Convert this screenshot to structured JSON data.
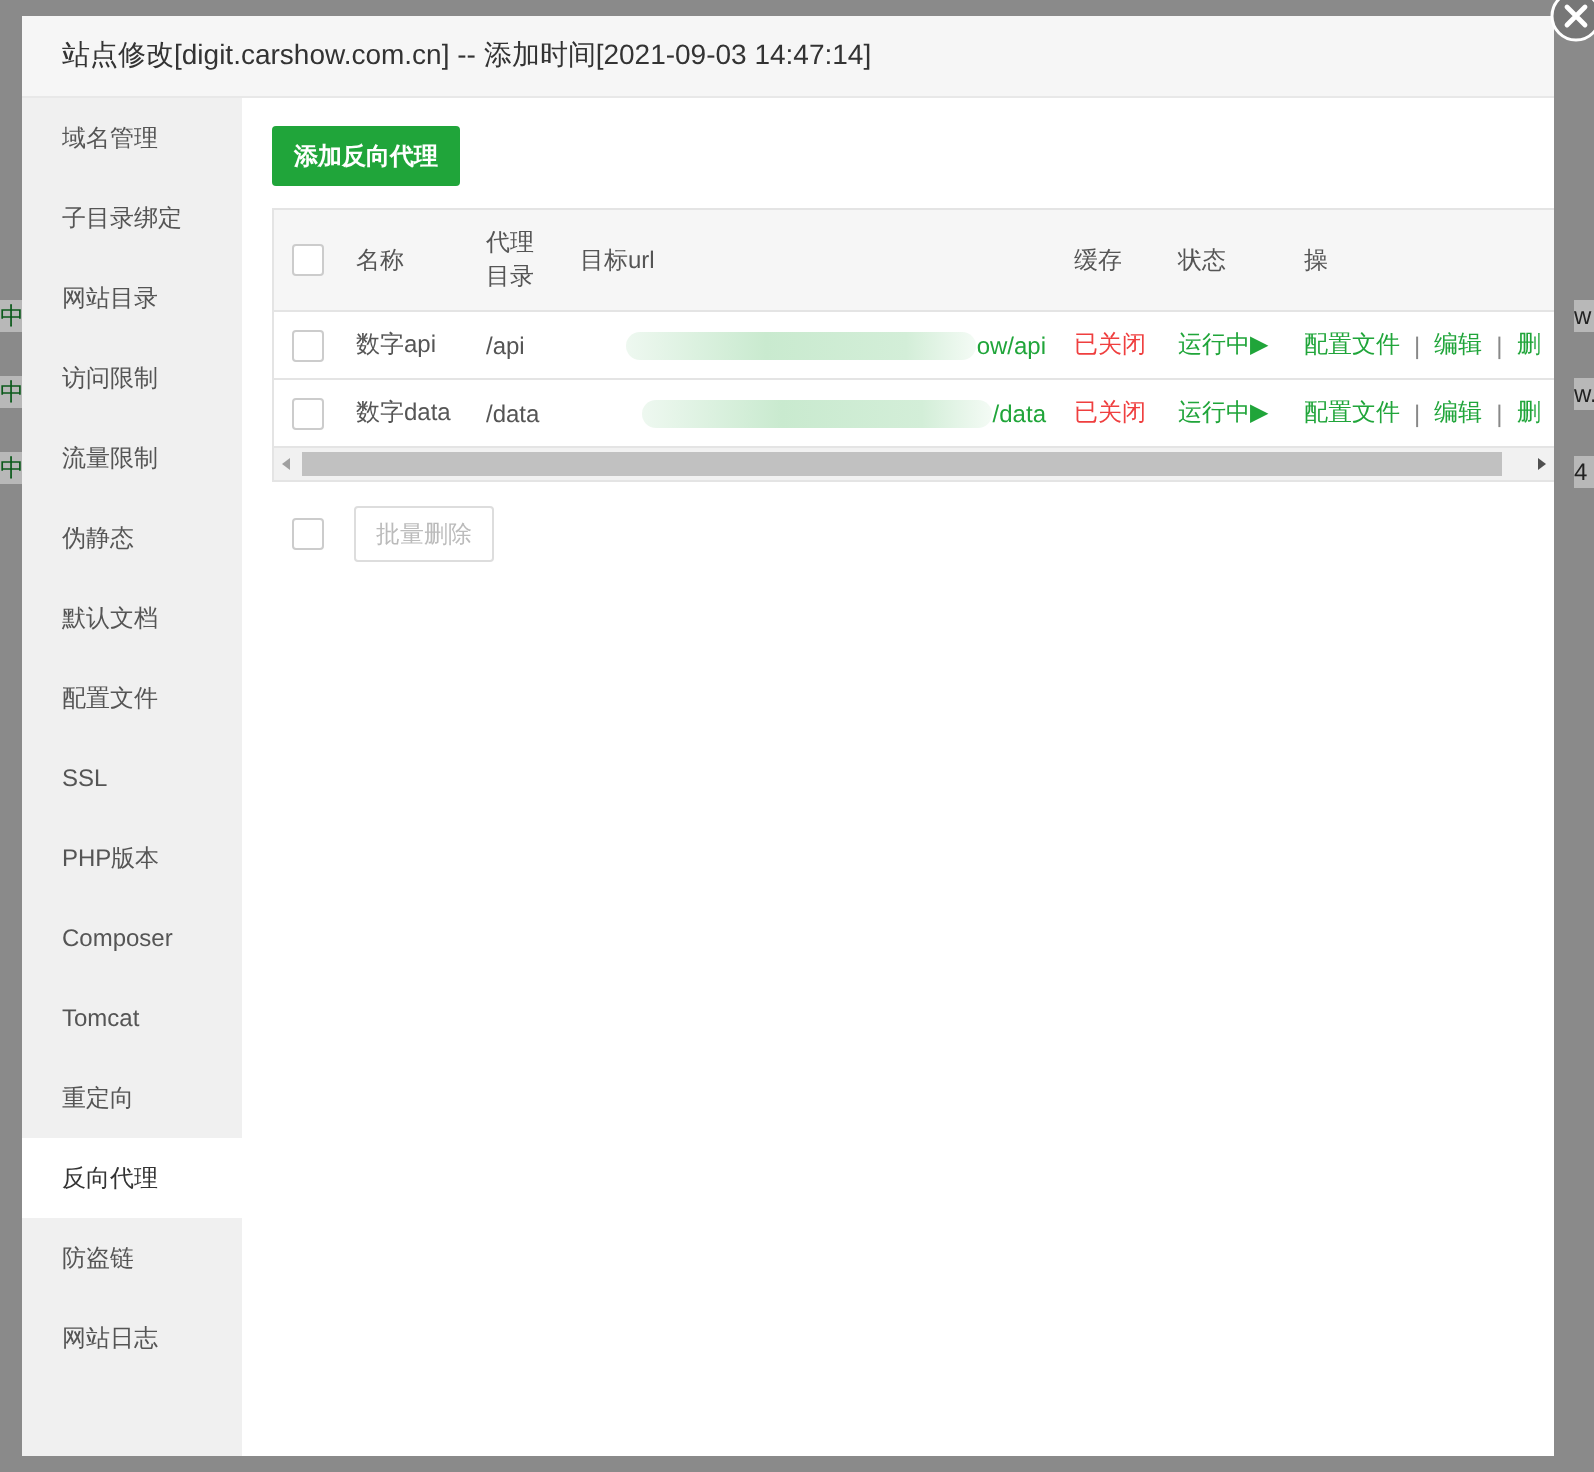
{
  "background": {
    "left_fragments": [
      "中",
      "中",
      "中"
    ],
    "right_fragments": [
      "w",
      "w.",
      "4"
    ]
  },
  "dialog": {
    "title": "站点修改[digit.carshow.com.cn] -- 添加时间[2021-09-03 14:47:14]"
  },
  "sidebar": {
    "items": [
      {
        "label": "域名管理",
        "selected": false
      },
      {
        "label": "子目录绑定",
        "selected": false
      },
      {
        "label": "网站目录",
        "selected": false
      },
      {
        "label": "访问限制",
        "selected": false
      },
      {
        "label": "流量限制",
        "selected": false
      },
      {
        "label": "伪静态",
        "selected": false
      },
      {
        "label": "默认文档",
        "selected": false
      },
      {
        "label": "配置文件",
        "selected": false
      },
      {
        "label": "SSL",
        "selected": false
      },
      {
        "label": "PHP版本",
        "selected": false
      },
      {
        "label": "Composer",
        "selected": false
      },
      {
        "label": "Tomcat",
        "selected": false
      },
      {
        "label": "重定向",
        "selected": false
      },
      {
        "label": "反向代理",
        "selected": true
      },
      {
        "label": "防盗链",
        "selected": false
      },
      {
        "label": "网站日志",
        "selected": false
      }
    ]
  },
  "add_button": "添加反向代理",
  "table": {
    "header_checked": false,
    "columns": [
      "名称",
      "代理目录",
      "目标url",
      "缓存",
      "状态",
      "操"
    ],
    "rows": [
      {
        "checked": false,
        "name": "数字api",
        "directory": "/api",
        "target_url": "ow/api",
        "url_redacted": true,
        "cache": "已关闭",
        "cache_on": false,
        "status": "运行中▶",
        "running": true,
        "actions": [
          "配置文件",
          "|",
          "编辑",
          "|",
          "删"
        ]
      },
      {
        "checked": false,
        "name": "数字data",
        "directory": "/data",
        "target_url": "/data",
        "url_redacted": true,
        "cache": "已关闭",
        "cache_on": false,
        "status": "运行中▶",
        "running": true,
        "actions": [
          "配置文件",
          "|",
          "编辑",
          "|",
          "删"
        ]
      }
    ]
  },
  "bulk": {
    "checked": false,
    "button": "批量删除"
  }
}
